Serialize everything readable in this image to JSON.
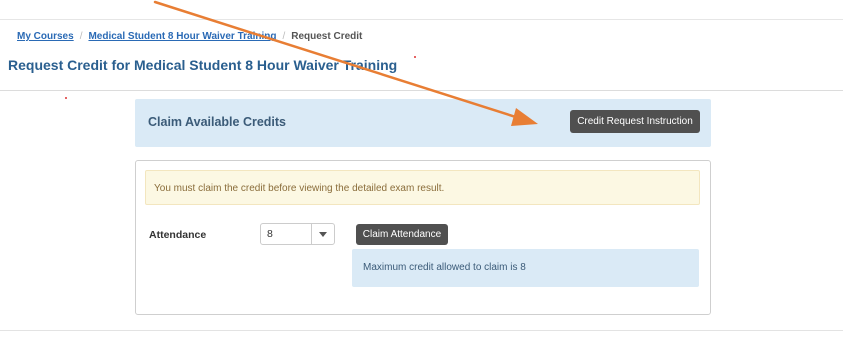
{
  "breadcrumb": {
    "my_courses": "My Courses",
    "course": "Medical Student 8 Hour Waiver Training",
    "current": "Request Credit",
    "separator": "/"
  },
  "page_title": "Request Credit for Medical Student 8 Hour Waiver Training",
  "claim_header": {
    "title": "Claim Available Credits",
    "instruction_button": "Credit Request Instruction"
  },
  "panel": {
    "warning": "You must claim the credit before viewing the detailed exam result.",
    "attendance_label": "Attendance",
    "attendance_value": "8",
    "claim_button": "Claim Attendance",
    "info": "Maximum credit allowed to claim is 8"
  },
  "colors": {
    "annotation_arrow": "#e87e34",
    "button_dark": "#505050",
    "info_bg": "#daeaf6",
    "warning_bg": "#fcf8e3",
    "title_blue": "#2a5f8f",
    "link_blue": "#2a6ab5"
  },
  "icons": {
    "dropdown": "chevron-down-icon",
    "annotation": "annotation-arrow"
  }
}
